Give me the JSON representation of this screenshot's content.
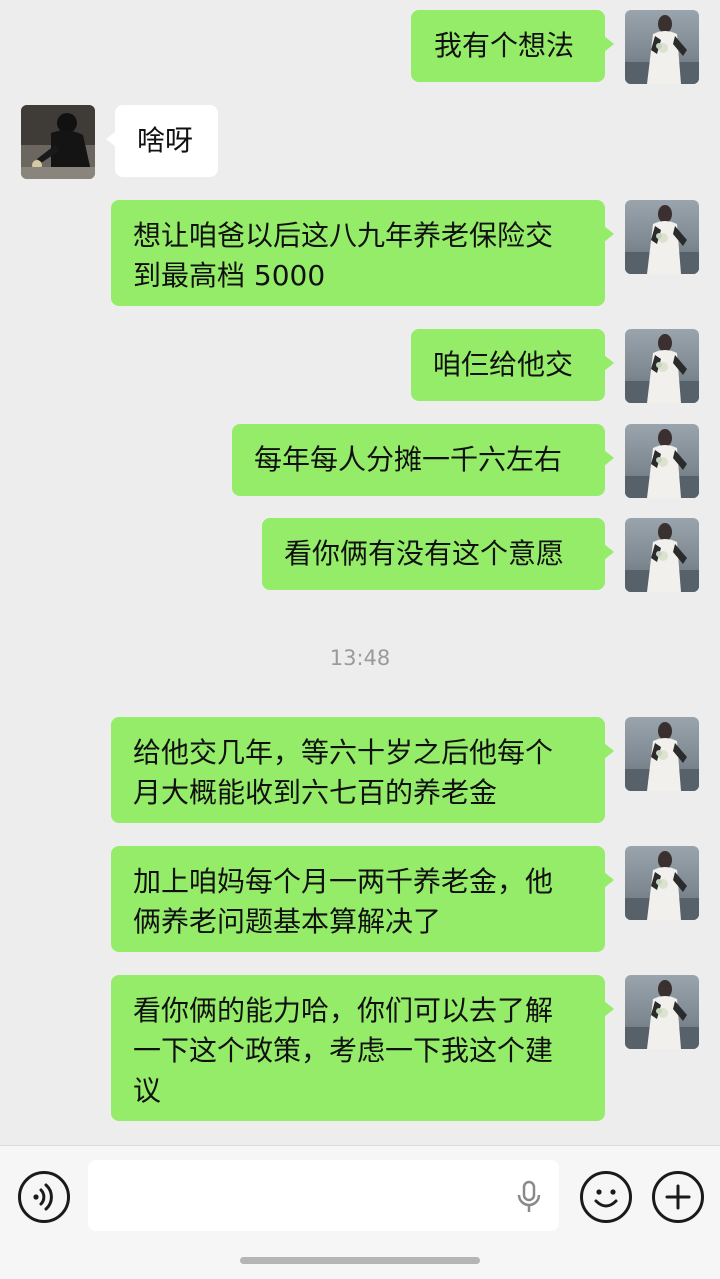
{
  "messages": [
    {
      "from": "me",
      "text": "我有个想法"
    },
    {
      "from": "other",
      "text": "啥呀"
    },
    {
      "from": "me",
      "line1": "想让咱爸以后这八九年养老保险交",
      "line2": "到最高档 5000"
    },
    {
      "from": "me",
      "text": "咱仨给他交"
    },
    {
      "from": "me",
      "text": "每年每人分摊一千六左右"
    },
    {
      "from": "me",
      "text": "看你俩有没有这个意愿"
    },
    {
      "from": "me",
      "line1": "给他交几年，等六十岁之后他每个",
      "line2": "月大概能收到六七百的养老金"
    },
    {
      "from": "me",
      "line1": "加上咱妈每个月一两千养老金，他",
      "line2": "俩养老问题基本算解决了"
    },
    {
      "from": "me",
      "line1": "看你俩的能力哈，你们可以去了解",
      "line2": "一下这个政策，考虑一下我这个建",
      "line3": "议"
    }
  ],
  "timestamp": "13:48",
  "composer": {
    "voice_icon": "voice-toggle-icon",
    "input_value": "",
    "mic_icon": "microphone-icon",
    "emoji_icon": "emoji-icon",
    "plus_icon": "plus-icon"
  },
  "colors": {
    "background": "#ededed",
    "my_bubble": "#95ec69",
    "their_bubble": "#ffffff",
    "timestamp": "#9a9a9a"
  }
}
